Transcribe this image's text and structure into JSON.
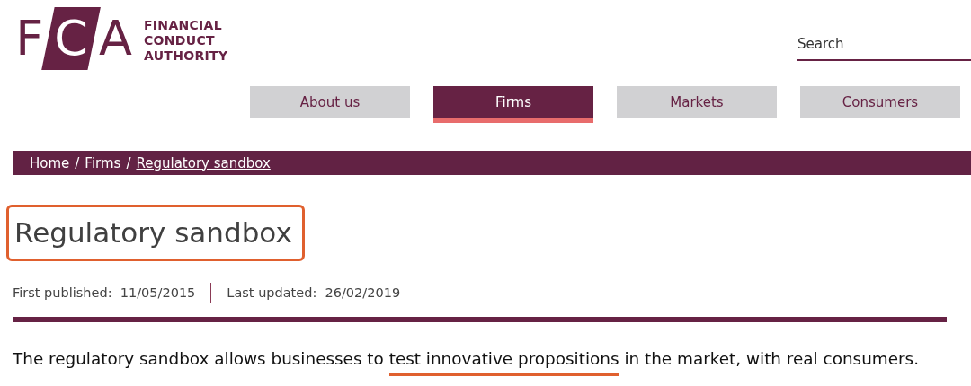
{
  "logo": {
    "mark": "FCA",
    "name_lines": [
      "FINANCIAL",
      "CONDUCT",
      "AUTHORITY"
    ]
  },
  "search": {
    "placeholder": "Search"
  },
  "nav": [
    {
      "label": "About us",
      "selected": false
    },
    {
      "label": "Firms",
      "selected": true
    },
    {
      "label": "Markets",
      "selected": false
    },
    {
      "label": "Consumers",
      "selected": false
    }
  ],
  "breadcrumb_separator": "/",
  "breadcrumb": [
    {
      "label": "Home",
      "current": false
    },
    {
      "label": "Firms",
      "current": false
    },
    {
      "label": "Regulatory sandbox",
      "current": true
    }
  ],
  "title": {
    "text": "Regulatory sandbox",
    "annotated": true
  },
  "meta": [
    {
      "label": "First published:",
      "value": "11/05/2015"
    },
    {
      "label": "Last updated:",
      "value": "26/02/2019"
    }
  ],
  "intro": [
    {
      "text": "The regulatory sandbox allows businesses to ",
      "annotated": false
    },
    {
      "text": "test innovative propositions",
      "annotated": true
    },
    {
      "text": " in the market, with real consumers.",
      "annotated": false
    }
  ]
}
